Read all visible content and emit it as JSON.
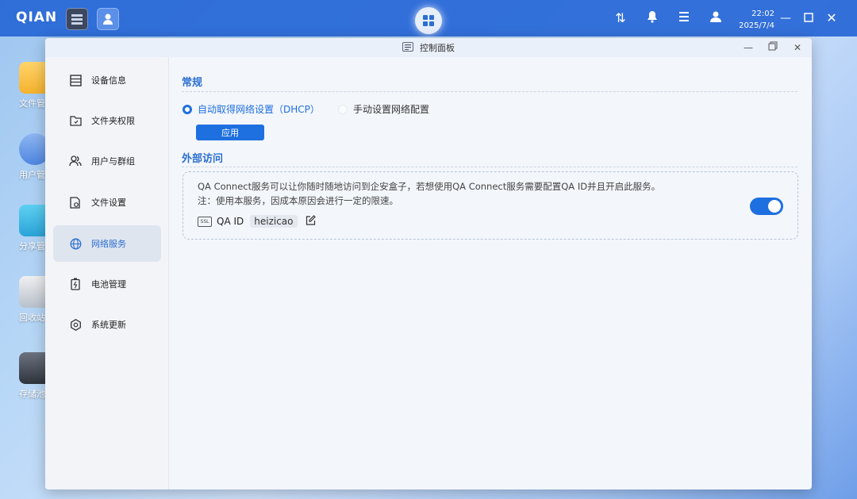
{
  "taskbar": {
    "logo": "QIAN",
    "time": "22:02",
    "date": "2025/7/4",
    "icons": [
      "server-app-icon",
      "user-app-icon",
      "start-menu-icon",
      "transfer-icon",
      "bell-icon",
      "menu-list-icon",
      "user-icon",
      "minimize-icon",
      "maximize-icon",
      "close-icon"
    ]
  },
  "desktop": {
    "items": [
      {
        "label": "文件管"
      },
      {
        "label": "用户管"
      },
      {
        "label": "分享管"
      },
      {
        "label": "回收站"
      },
      {
        "label": "存储池"
      }
    ]
  },
  "window": {
    "title": "控制面板"
  },
  "sidebar": {
    "items": [
      {
        "label": "设备信息",
        "icon": "device-info-icon"
      },
      {
        "label": "文件夹权限",
        "icon": "folder-permission-icon"
      },
      {
        "label": "用户与群组",
        "icon": "users-group-icon"
      },
      {
        "label": "文件设置",
        "icon": "file-settings-icon"
      },
      {
        "label": "网络服务",
        "icon": "globe-icon",
        "active": true
      },
      {
        "label": "电池管理",
        "icon": "battery-icon"
      },
      {
        "label": "系统更新",
        "icon": "gear-icon"
      }
    ]
  },
  "main": {
    "general": {
      "title": "常规",
      "option_dhcp": "自动取得网络设置（DHCP）",
      "option_manual": "手动设置网络配置",
      "selected": "dhcp",
      "apply_label": "应用"
    },
    "external": {
      "title": "外部访问",
      "desc1": "QA Connect服务可以让你随时随地访问到企安盒子，若想使用QA Connect服务需要配置QA ID并且开启此服务。",
      "desc2": "注：使用本服务，因成本原因会进行一定的限速。",
      "ssl_badge": "SSL",
      "qa_id_label": "QA ID",
      "qa_id_value": "heizicao",
      "enabled": true
    }
  },
  "colors": {
    "accent": "#1e6fe0",
    "taskbar": "#2666d6"
  }
}
